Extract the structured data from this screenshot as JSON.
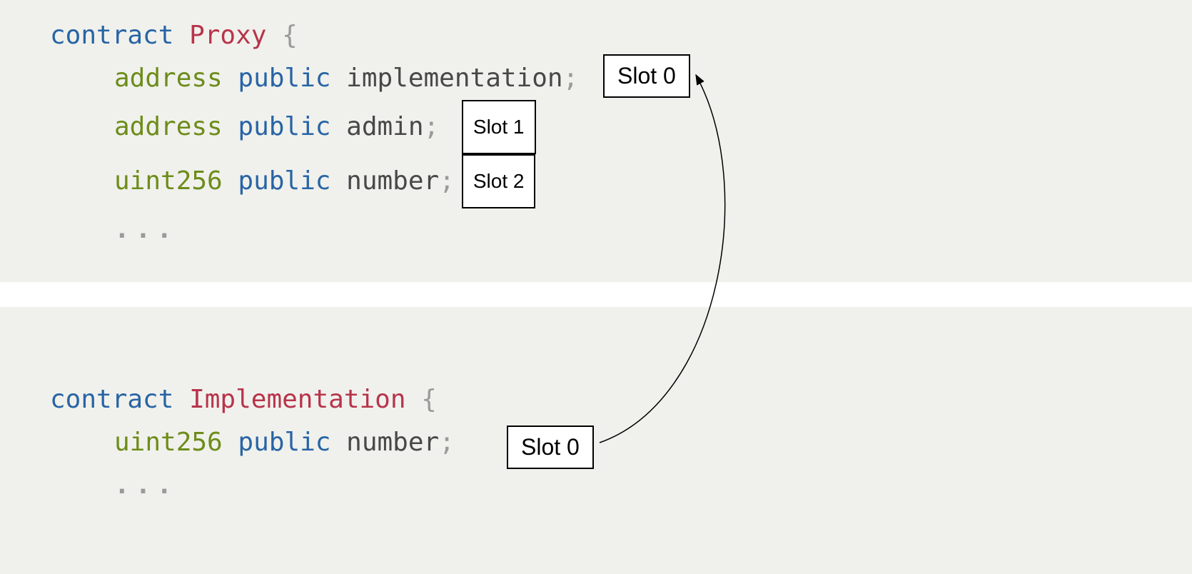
{
  "colors": {
    "background": "#f0f1ec",
    "keyword_blue": "#2864a5",
    "type_green": "#6d8c1a",
    "name_red": "#b7344b",
    "ident_dark": "#484848",
    "muted": "#9a9a9a"
  },
  "proxy": {
    "keyword": "contract",
    "name": "Proxy",
    "open_brace": "{",
    "lines": [
      {
        "type": "address",
        "visibility": "public",
        "ident": "implementation",
        "semi": ";",
        "slot": "Slot 0"
      },
      {
        "type": "address",
        "visibility": "public",
        "ident": "admin",
        "semi": ";",
        "slot": "Slot 1"
      },
      {
        "type": "uint256",
        "visibility": "public",
        "ident": "number",
        "semi": ";",
        "slot": "Slot 2"
      }
    ],
    "ellipsis": "..."
  },
  "impl": {
    "keyword": "contract",
    "name": "Implementation",
    "open_brace": "{",
    "lines": [
      {
        "type": "uint256",
        "visibility": "public",
        "ident": "number",
        "semi": ";",
        "slot": "Slot 0"
      }
    ],
    "ellipsis": "..."
  },
  "slot_labels": {
    "top": "Slot 0",
    "bottom": "Slot 0"
  }
}
